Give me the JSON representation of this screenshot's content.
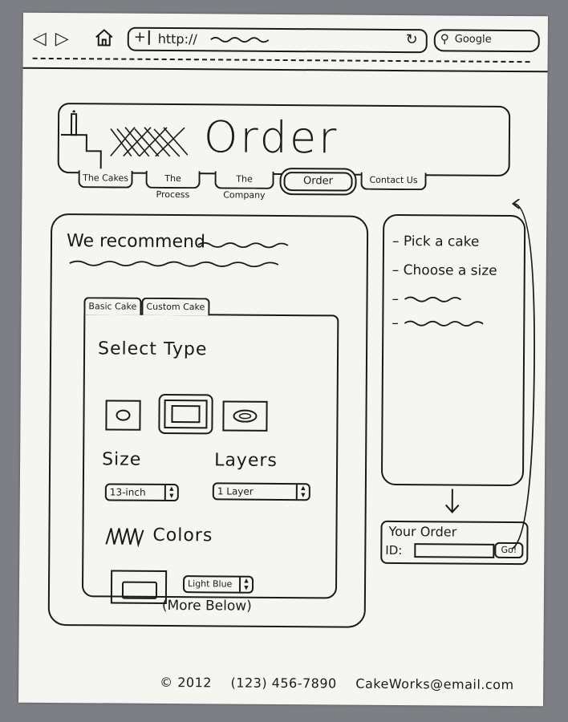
{
  "browser": {
    "back_icon": "back-arrow-icon",
    "forward_icon": "forward-arrow-icon",
    "home_icon": "home-icon",
    "new_tab_label": "+",
    "url": "http://",
    "reload_icon": "reload-icon",
    "search_placeholder": "Google"
  },
  "header": {
    "title": "Order"
  },
  "nav": {
    "tabs": [
      {
        "label": "The Cakes"
      },
      {
        "label": "The Process"
      },
      {
        "label": "The Company"
      },
      {
        "label": "Order"
      },
      {
        "label": "Contact Us"
      }
    ],
    "active_index": 3
  },
  "main": {
    "recommend_label": "We recommend",
    "tabs": [
      {
        "label": "Basic Cake"
      },
      {
        "label": "Custom Cake"
      }
    ],
    "select_type_heading": "Select Type",
    "size_heading": "Size",
    "size_value": "13-inch",
    "layers_heading": "Layers",
    "layers_value": "1 Layer",
    "colors_heading": "Colors",
    "color_value": "Light Blue",
    "more_below": "(More Below)"
  },
  "steps": {
    "items": [
      {
        "label": "Pick a cake"
      },
      {
        "label": "Choose a size"
      }
    ]
  },
  "order": {
    "title": "Your Order",
    "id_label": "ID:",
    "go_label": "Go!"
  },
  "footer": {
    "copyright": "© 2012",
    "phone": "(123) 456-7890",
    "email": "CakeWorks@email.com"
  }
}
